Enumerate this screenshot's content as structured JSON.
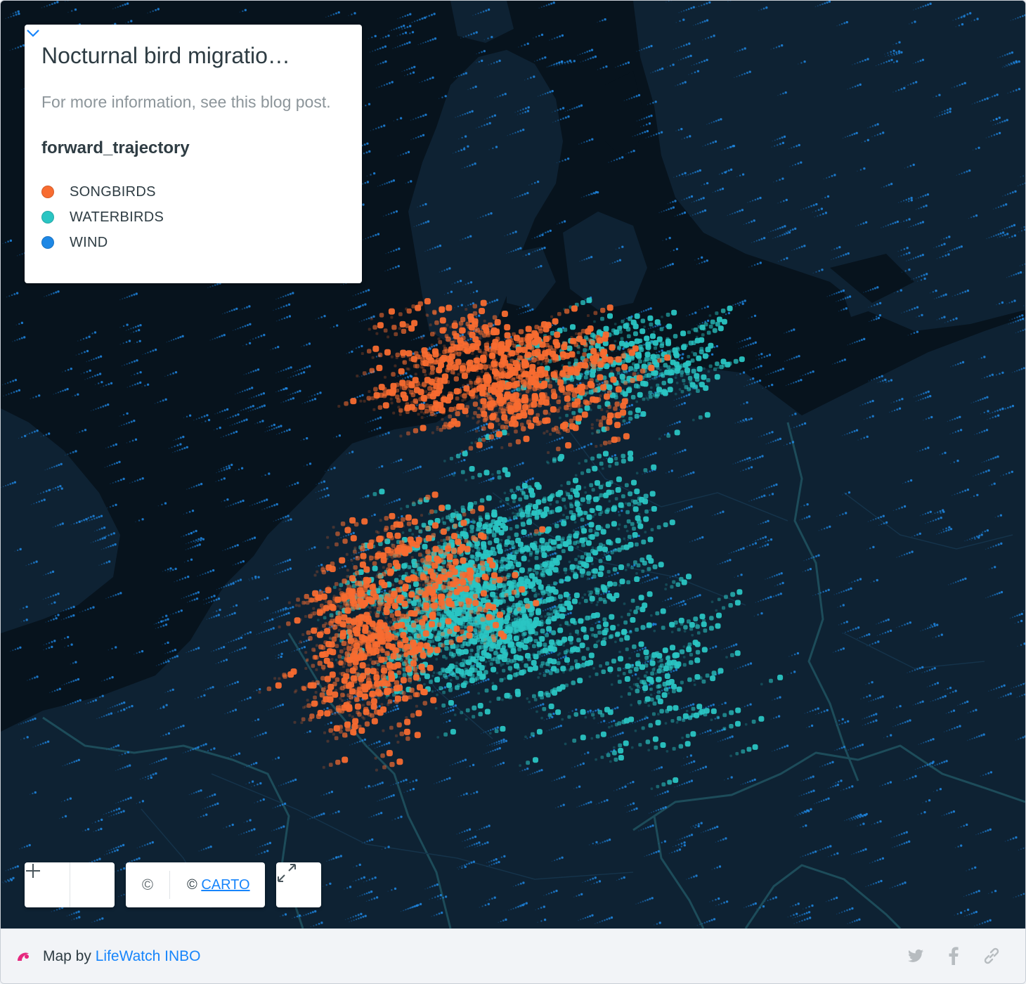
{
  "legend": {
    "title": "Nocturnal bird migratio…",
    "description": "For more information, see this blog post.",
    "attribute": "forward_trajectory",
    "items": [
      {
        "label": "SONGBIRDS",
        "color": "#f86c30"
      },
      {
        "label": "WATERBIRDS",
        "color": "#2ac5c3"
      },
      {
        "label": "WIND",
        "color": "#1e88e5"
      }
    ]
  },
  "attribution": {
    "copyright_symbol": "©",
    "prefix": "©",
    "link": "CARTO"
  },
  "footer": {
    "prefix": "Map by",
    "author": "LifeWatch INBO"
  },
  "map": {
    "basemap": "dark",
    "land_color": "#0e2233",
    "water_color": "#07131d",
    "border_color": "#1d4c5a"
  },
  "icons": [
    "chevron-down-icon",
    "zoom-out-icon",
    "zoom-in-icon",
    "copyright-icon",
    "fullscreen-icon",
    "carto-logo-icon",
    "twitter-icon",
    "facebook-icon",
    "link-icon"
  ]
}
